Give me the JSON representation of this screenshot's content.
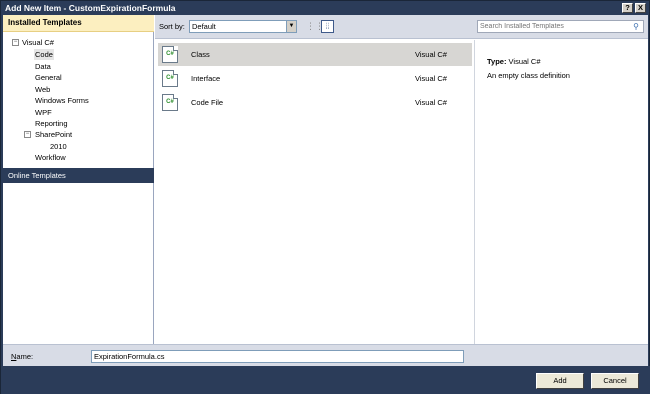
{
  "window": {
    "title": "Add New Item - CustomExpirationFormula",
    "help_label": "?",
    "close_label": "X"
  },
  "left_panel": {
    "header": "Installed Templates",
    "tree": [
      {
        "label": "Visual C#",
        "toggle": "−"
      },
      {
        "label": "Code",
        "selected": true
      },
      {
        "label": "Data"
      },
      {
        "label": "General"
      },
      {
        "label": "Web"
      },
      {
        "label": "Windows Forms"
      },
      {
        "label": "WPF"
      },
      {
        "label": "Reporting"
      },
      {
        "label": "SharePoint",
        "toggle": "−"
      },
      {
        "label": "2010"
      },
      {
        "label": "Workflow"
      }
    ],
    "online_templates": "Online Templates"
  },
  "toolbar": {
    "sort_label": "Sort by:",
    "sort_value": "Default",
    "sort_arrow": "▼",
    "view_list_icon": "⋮⋮",
    "view_detail_icon": "⦙⦙",
    "search_placeholder": "Search Installed Templates",
    "search_icon": "⚲"
  },
  "templates": [
    {
      "name": "Class",
      "language": "Visual C#",
      "icon_text": "C#",
      "selected": true
    },
    {
      "name": "Interface",
      "language": "Visual C#",
      "icon_text": "C#"
    },
    {
      "name": "Code File",
      "language": "Visual C#",
      "icon_text": "C#"
    }
  ],
  "details": {
    "type_label": "Type:",
    "type_value": "Visual C#",
    "description": "An empty class definition"
  },
  "name_field": {
    "label_accel": "N",
    "label_rest": "ame:",
    "value": "ExpirationFormula.cs"
  },
  "buttons": {
    "add": "Add",
    "cancel": "Cancel"
  }
}
